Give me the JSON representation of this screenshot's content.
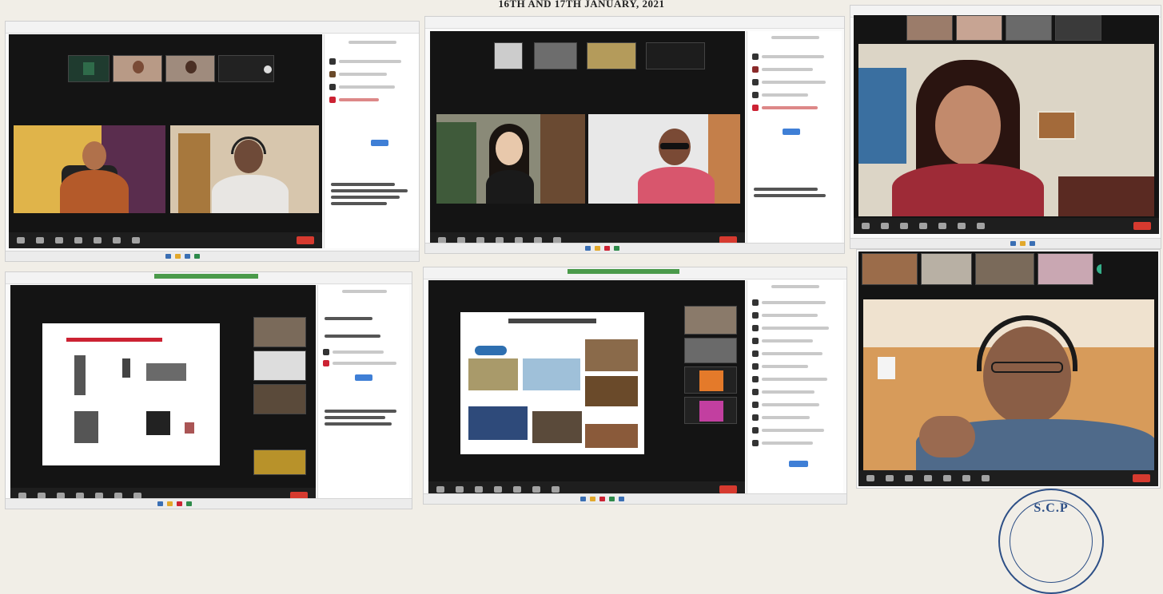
{
  "header": {
    "title": "16TH AND 17TH JANUARY, 2021"
  },
  "seal": {
    "text": "S.C.P"
  },
  "colors": {
    "background": "#f1eee7",
    "meeting_bg": "#141414",
    "end_button": "#d63a2f",
    "seal": "#2d4f86"
  },
  "panels": [
    {
      "id": "top-left",
      "content": "two participants gallery with chat sidebar"
    },
    {
      "id": "top-middle",
      "content": "two participants gallery with participant list sidebar"
    },
    {
      "id": "top-right",
      "content": "single speaker view with filmstrip"
    },
    {
      "id": "bottom-left",
      "content": "shared slide with speaker thumbnails and chat"
    },
    {
      "id": "bottom-middle",
      "content": "shared photo slide with participant list"
    },
    {
      "id": "bottom-right",
      "content": "single speaker view with filmstrip"
    }
  ],
  "icons": [
    "mute-icon",
    "video-icon",
    "participants-icon",
    "chat-icon",
    "share-screen-icon",
    "record-icon",
    "reactions-icon",
    "end-meeting-icon"
  ]
}
